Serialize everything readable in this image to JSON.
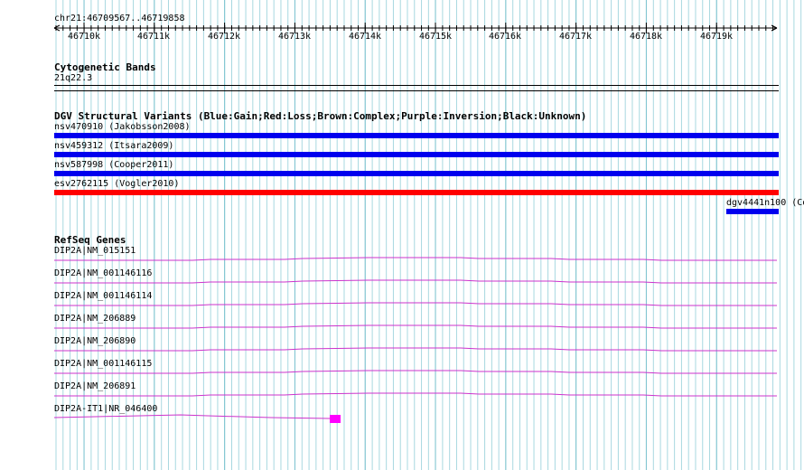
{
  "ruler": {
    "coordinates": "chr21:46709567..46719858",
    "ticks": [
      "46710k",
      "46711k",
      "46712k",
      "46713k",
      "46714k",
      "46715k",
      "46716k",
      "46717k",
      "46718k",
      "46719k"
    ]
  },
  "cytoband": {
    "title": "Cytogenetic Bands",
    "band": "21q22.3"
  },
  "dgv": {
    "title": "DGV Structural Variants (Blue:Gain;Red:Loss;Brown:Complex;Purple:Inversion;Black:Unknown)",
    "items": [
      {
        "label": "nsv470910 (Jakobsson2008)",
        "color": "#0000ee"
      },
      {
        "label": "nsv459312 (Itsara2009)",
        "color": "#0000ee"
      },
      {
        "label": "nsv587998 (Cooper2011)",
        "color": "#0000ee"
      },
      {
        "label": "esv2762115 (Vogler2010)",
        "color": "#ff0000"
      },
      {
        "label": "dgv4441n100 (Co",
        "color": "#0000ee"
      }
    ]
  },
  "refseq": {
    "title": "RefSeq Genes",
    "genes": [
      "DIP2A|NM_015151",
      "DIP2A|NM_001146116",
      "DIP2A|NM_001146114",
      "DIP2A|NM_206889",
      "DIP2A|NM_206890",
      "DIP2A|NM_001146115",
      "DIP2A|NM_206891",
      "DIP2A-IT1|NR_046400"
    ],
    "gene_color": "#cc33cc",
    "exon_color": "#ff00ff"
  },
  "colors": {
    "grid": "#a8d8e0",
    "gain": "#0000ee",
    "loss": "#ff0000"
  }
}
